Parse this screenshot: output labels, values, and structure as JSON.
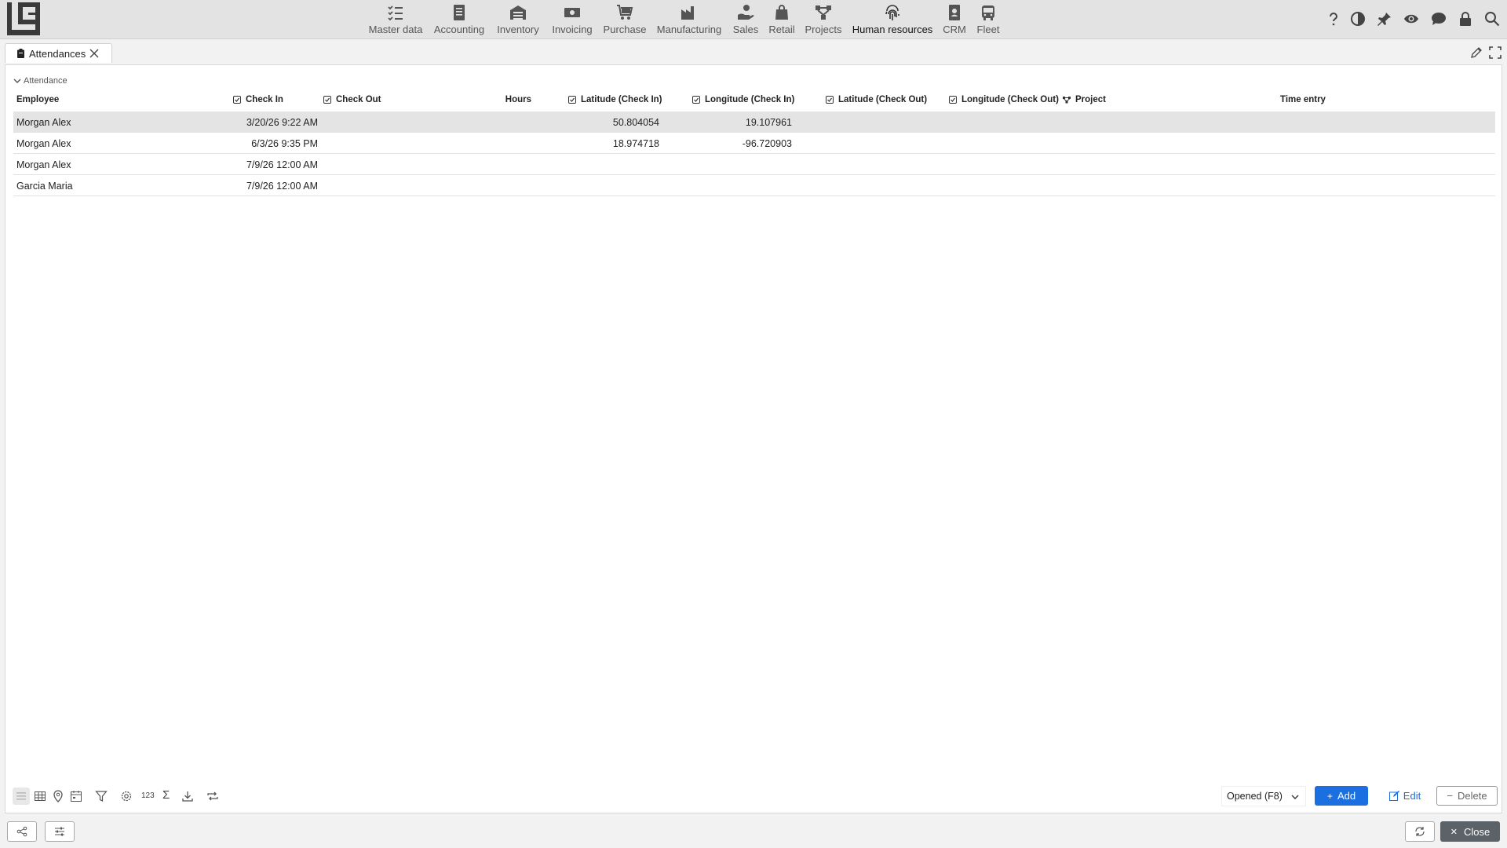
{
  "colors": {
    "accent": "#1b6fe0",
    "topbar_bg": "#e3e3e3",
    "selected_row": "#e4e4e4",
    "close_button_bg": "#5b6268"
  },
  "nav": {
    "modules": [
      {
        "label": "Master data",
        "icon": "checklist-icon"
      },
      {
        "label": "Accounting",
        "icon": "ledger-icon"
      },
      {
        "label": "Inventory",
        "icon": "warehouse-icon"
      },
      {
        "label": "Invoicing",
        "icon": "banknote-icon"
      },
      {
        "label": "Purchase",
        "icon": "cart-icon"
      },
      {
        "label": "Manufacturing",
        "icon": "factory-icon"
      },
      {
        "label": "Sales",
        "icon": "hand-money-icon"
      },
      {
        "label": "Retail",
        "icon": "shopping-bag-icon"
      },
      {
        "label": "Projects",
        "icon": "project-tree-icon"
      },
      {
        "label": "Human resources",
        "icon": "fingerprint-icon"
      },
      {
        "label": "CRM",
        "icon": "contact-book-icon"
      },
      {
        "label": "Fleet",
        "icon": "bus-icon"
      }
    ],
    "active_module": "Human resources",
    "right_icons": [
      "help-icon",
      "contrast-icon",
      "pin-icon",
      "eye-icon",
      "chat-icon",
      "lock-icon",
      "search-icon"
    ]
  },
  "tabs": [
    {
      "label": "Attendances",
      "icon": "clipboard-icon",
      "closable": true
    }
  ],
  "panel": {
    "section_label": "Attendance",
    "columns": {
      "employee": "Employee",
      "check_in": "Check In",
      "check_out": "Check Out",
      "hours": "Hours",
      "lat_in": "Latitude (Check In)",
      "lon_in": "Longitude (Check In)",
      "lat_out": "Latitude (Check Out)",
      "lon_out": "Longitude (Check Out)",
      "project": "Project",
      "time_entry": "Time entry"
    },
    "rows": [
      {
        "employee": "Morgan Alex",
        "check_in": "3/20/26 9:22 AM",
        "check_out": "",
        "hours": "",
        "lat_in": "50.804054",
        "lon_in": "19.107961",
        "lat_out": "",
        "lon_out": "",
        "project": "",
        "time_entry": "",
        "selected": true
      },
      {
        "employee": "Morgan Alex",
        "check_in": "6/3/26 9:35 PM",
        "check_out": "",
        "hours": "",
        "lat_in": "18.974718",
        "lon_in": "-96.720903",
        "lat_out": "",
        "lon_out": "",
        "project": "",
        "time_entry": "",
        "selected": false
      },
      {
        "employee": "Morgan Alex",
        "check_in": "7/9/26 12:00 AM",
        "check_out": "",
        "hours": "",
        "lat_in": "",
        "lon_in": "",
        "lat_out": "",
        "lon_out": "",
        "project": "",
        "time_entry": "",
        "selected": false
      },
      {
        "employee": "Garcia Maria",
        "check_in": "7/9/26 12:00 AM",
        "check_out": "",
        "hours": "",
        "lat_in": "",
        "lon_in": "",
        "lat_out": "",
        "lon_out": "",
        "project": "",
        "time_entry": "",
        "selected": false
      }
    ]
  },
  "footer": {
    "tools": [
      "list-view-icon",
      "grid-view-icon",
      "map-pin-icon",
      "calendar-view-icon",
      "filter-icon",
      "settings-icon",
      "counter-icon",
      "sum-icon",
      "download-icon",
      "repeat-icon"
    ],
    "counter_label": "123",
    "sum_label": "Σ",
    "filter_value": "Opened (F8)",
    "add_label": "Add",
    "edit_label": "Edit",
    "delete_label": "Delete"
  },
  "bottombar": {
    "close_label": "Close"
  }
}
